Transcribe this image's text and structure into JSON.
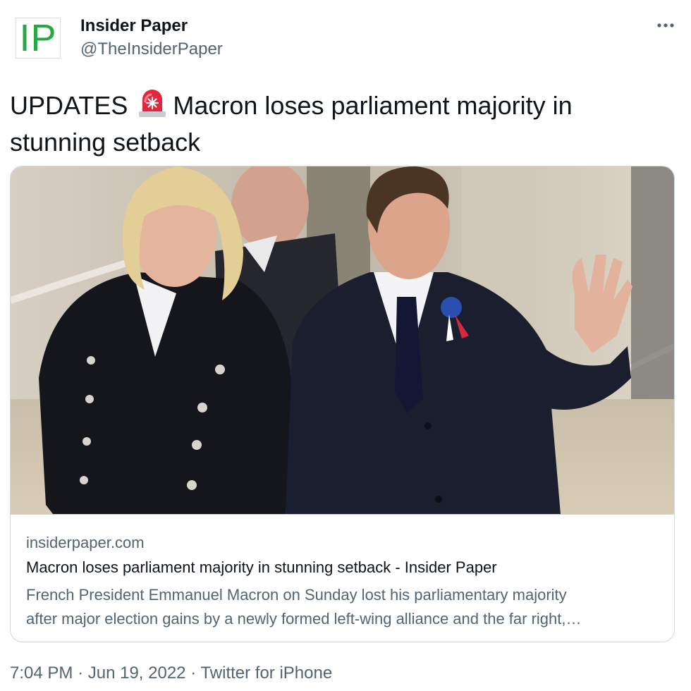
{
  "account": {
    "avatar_text": "IP",
    "display_name": "Insider Paper",
    "handle": "@TheInsiderPaper"
  },
  "tweet": {
    "text_before_emoji": "UPDATES",
    "emoji_icon": "rotating-light-icon",
    "text_line_1_after_emoji": "Macron loses parliament majority in",
    "text_line_2": "stunning setback"
  },
  "card": {
    "domain": "insiderpaper.com",
    "title": "Macron loses parliament majority in stunning setback - Insider Paper",
    "description_line_1": "French President Emmanuel Macron on Sunday lost his parliamentary majority",
    "description_line_2": "after major election gains by a newly formed left-wing alliance and the far right,…"
  },
  "meta": {
    "time": "7:04 PM",
    "separator": "·",
    "date": "Jun 19, 2022",
    "source": "Twitter for iPhone"
  },
  "colors": {
    "text_primary": "#0f1419",
    "text_secondary": "#536471",
    "border": "#cfd9de",
    "logo_green": "#27a844"
  }
}
